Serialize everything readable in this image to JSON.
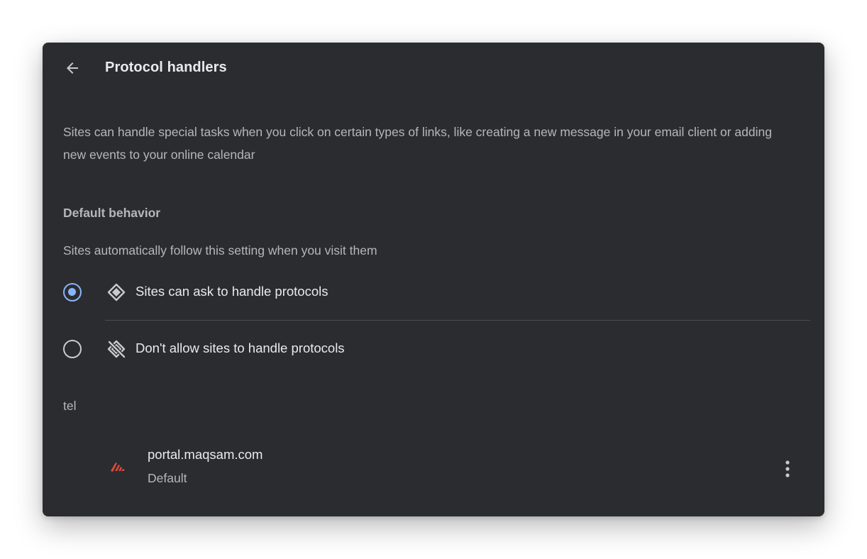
{
  "header": {
    "title": "Protocol handlers",
    "back_icon": "arrow-back-icon"
  },
  "description": "Sites can handle special tasks when you click on certain types of links, like creating a new message in your email client or adding new events to your online calendar",
  "default_behavior": {
    "title": "Default behavior",
    "subtitle": "Sites automatically follow this setting when you visit them",
    "options": [
      {
        "label": "Sites can ask to handle protocols",
        "icon": "protocol-handler-icon",
        "selected": true
      },
      {
        "label": "Don't allow sites to handle protocols",
        "icon": "protocol-handler-off-icon",
        "selected": false
      }
    ]
  },
  "handlers": {
    "protocol": "tel",
    "items": [
      {
        "site": "portal.maqsam.com",
        "status": "Default",
        "favicon": "maqsam-logo-icon",
        "menu_icon": "more-vert-icon"
      }
    ]
  },
  "colors": {
    "panel_bg": "#2b2c2f",
    "accent": "#8ab4f8",
    "text_primary": "#e8eaed",
    "text_secondary": "#b4b7bb",
    "favicon_red": "#e24a3b"
  }
}
